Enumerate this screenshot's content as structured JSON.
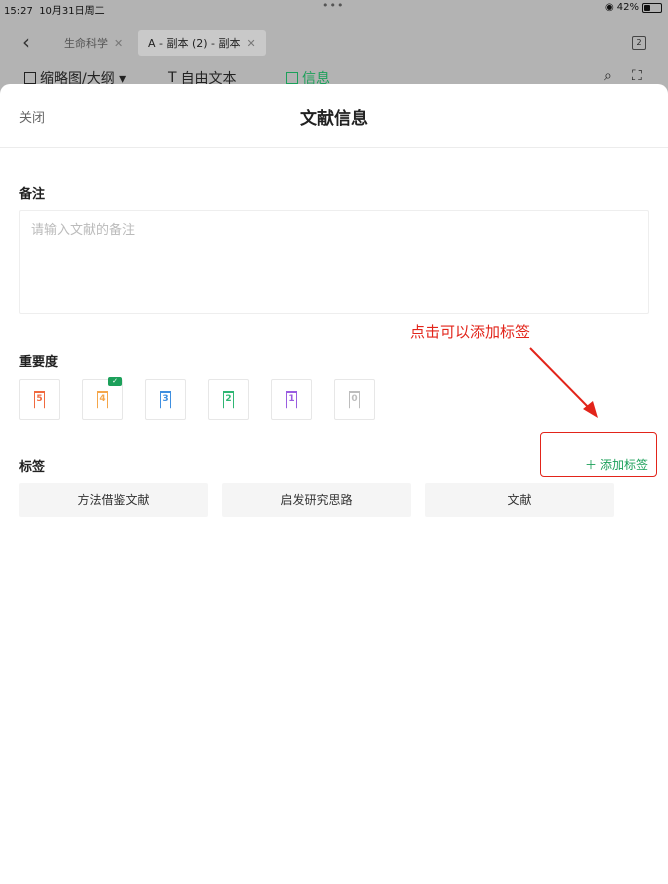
{
  "status": {
    "time": "15:27",
    "date": "10月31日周二",
    "battery": "42%",
    "battery_level": 0.42
  },
  "app": {
    "tabs": [
      {
        "label": "生命科学"
      },
      {
        "label": "A - 副本 (2) - 副本"
      }
    ],
    "page_count": "2",
    "toolbar": [
      {
        "label": "缩略图/大纲 ▾"
      },
      {
        "label": "自由文本"
      },
      {
        "label": "信息"
      }
    ]
  },
  "sheet": {
    "close_label": "关闭",
    "title": "文献信息",
    "notes": {
      "label": "备注",
      "placeholder": "请输入文献的备注",
      "value": ""
    },
    "importance": {
      "label": "重要度",
      "levels": [
        {
          "value": "5",
          "color": "#f06a3f"
        },
        {
          "value": "4",
          "color": "#f5a64a",
          "selected": true
        },
        {
          "value": "3",
          "color": "#3f8fe0"
        },
        {
          "value": "2",
          "color": "#2fb673"
        },
        {
          "value": "1",
          "color": "#9a5de0"
        },
        {
          "value": "0",
          "color": "#bdbdbd"
        }
      ]
    },
    "tags": {
      "label": "标签",
      "add_label": "添加标签",
      "items": [
        "方法借鉴文献",
        "启发研究思路",
        "文献"
      ]
    }
  },
  "annotation": {
    "text": "点击可以添加标签",
    "color": "#e2241a"
  }
}
